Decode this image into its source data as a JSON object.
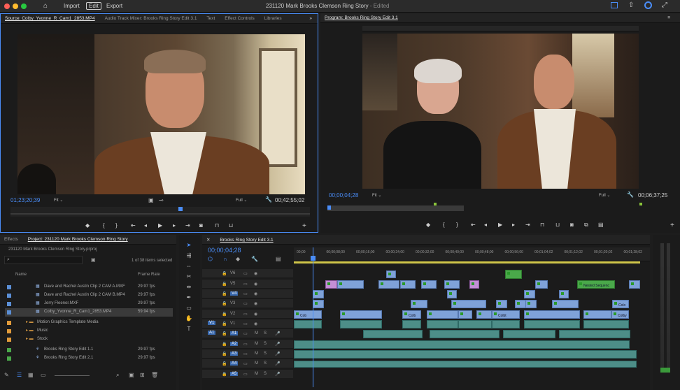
{
  "app": {
    "title": "231120 Mark Brooks Clemson Ring Story",
    "title_status": "- Edited",
    "tabs": [
      "Import",
      "Edit",
      "Export"
    ],
    "active_tab": "Edit"
  },
  "source_panel": {
    "tabs": [
      "Source: Colby_Yvonne_R_Cam1_2853.MP4",
      "Audio Track Mixer: Brooks Ring Story Edit 3.1",
      "Text",
      "Effect Controls",
      "Libraries"
    ],
    "timecode": "01;23;20;39",
    "fit": "Fit",
    "quality": "Full",
    "duration": "00;42;55;02"
  },
  "program_panel": {
    "title": "Program: Brooks Ring Story Edit 3.1",
    "timecode": "00;00;04;28",
    "fit": "Fit",
    "quality": "Full",
    "duration": "00;06;37;25"
  },
  "project_panel": {
    "tabs": [
      "Effects",
      "Project: 231120 Mark Brooks Clemson Ring Story"
    ],
    "project_file": "231120 Mark Brooks Clemson Ring Story.prproj",
    "selection_status": "1 of 38 items selected",
    "columns": [
      "Name",
      "Frame Rate"
    ],
    "items": [
      {
        "name": "Dave and Rachel Austin Clip 2 CAM A.MXF",
        "rate": "29.97 fps",
        "color": "#5b8fd6"
      },
      {
        "name": "Dave and Rachel Austin Clip 2 CAM B.MP4",
        "rate": "29.97 fps",
        "color": "#5b8fd6"
      },
      {
        "name": "Jerry Fleenor.MXF",
        "rate": "29.97 fps",
        "color": "#5b8fd6"
      },
      {
        "name": "Colby_Yvonne_R_Cam1_2853.MP4",
        "rate": "59.94 fps",
        "color": "#5b8fd6"
      },
      {
        "name": "Motion Graphics Template Media",
        "rate": "",
        "color": "#e09a3a"
      },
      {
        "name": "Music",
        "rate": "",
        "color": "#e09a3a"
      },
      {
        "name": "Stock",
        "rate": "",
        "color": "#e09a3a"
      },
      {
        "name": "Brooks Ring Story Edit 1.1",
        "rate": "29.97 fps",
        "color": "#4aa84a"
      },
      {
        "name": "Brooks Ring Story Edit 2.1",
        "rate": "29.97 fps",
        "color": "#4aa84a"
      }
    ]
  },
  "timeline": {
    "title": "Brooks Ring Story Edit 3.1",
    "timecode": "00;00;04;28",
    "ruler_ticks": [
      "00;00",
      "00;00;08;00",
      "00;00;16;00",
      "00;00;24;00",
      "00;00;32;00",
      "00;00;40;00",
      "00;00;48;00",
      "00;00;56;00",
      "00;01;04;02",
      "00;01;12;02",
      "00;01;20;02",
      "00;01;28;02"
    ],
    "video_tracks": [
      "V6",
      "V5",
      "V4",
      "V3",
      "V2",
      "V1"
    ],
    "audio_tracks": [
      "A1",
      "A2",
      "A3",
      "A4",
      "A5"
    ],
    "source_patch": {
      "video": "V1",
      "audio": "A1"
    },
    "clip_labels": {
      "nested": "Nested Sequenc",
      "colo": "Colo",
      "cob": "Cob",
      "colb": "Colb",
      "colbt": "Colbt",
      "colby": "Colby"
    }
  },
  "colors": {
    "accent": "#4a8df8",
    "video_clip": "#7fa2d8",
    "audio_clip": "#4d8e88",
    "green_clip": "#4aa84a",
    "purple_clip": "#c48fd6"
  }
}
